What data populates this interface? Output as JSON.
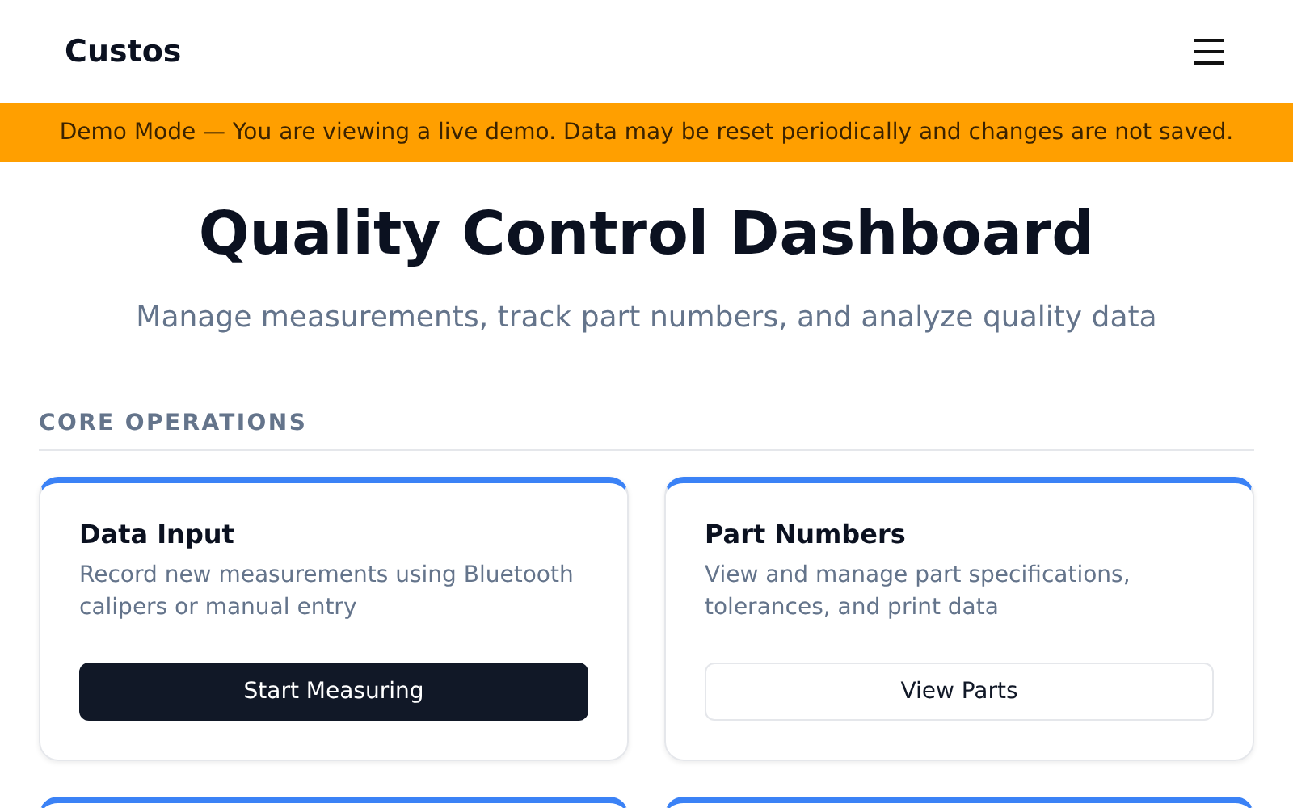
{
  "header": {
    "brand": "Custos"
  },
  "banner": {
    "text": "Demo Mode — You are viewing a live demo. Data may be reset periodically and changes are not saved."
  },
  "hero": {
    "title": "Quality Control Dashboard",
    "subtitle": "Manage measurements, track part numbers, and analyze quality data"
  },
  "section": {
    "heading": "CORE OPERATIONS",
    "cards": [
      {
        "title": "Data Input",
        "description": "Record new measurements using Bluetooth calipers or manual entry",
        "button": {
          "label": "Start Measuring",
          "kind": "primary"
        }
      },
      {
        "title": "Part Numbers",
        "description": "View and manage part specifications, tolerances, and print data",
        "button": {
          "label": "View Parts",
          "kind": "secondary"
        }
      }
    ]
  }
}
